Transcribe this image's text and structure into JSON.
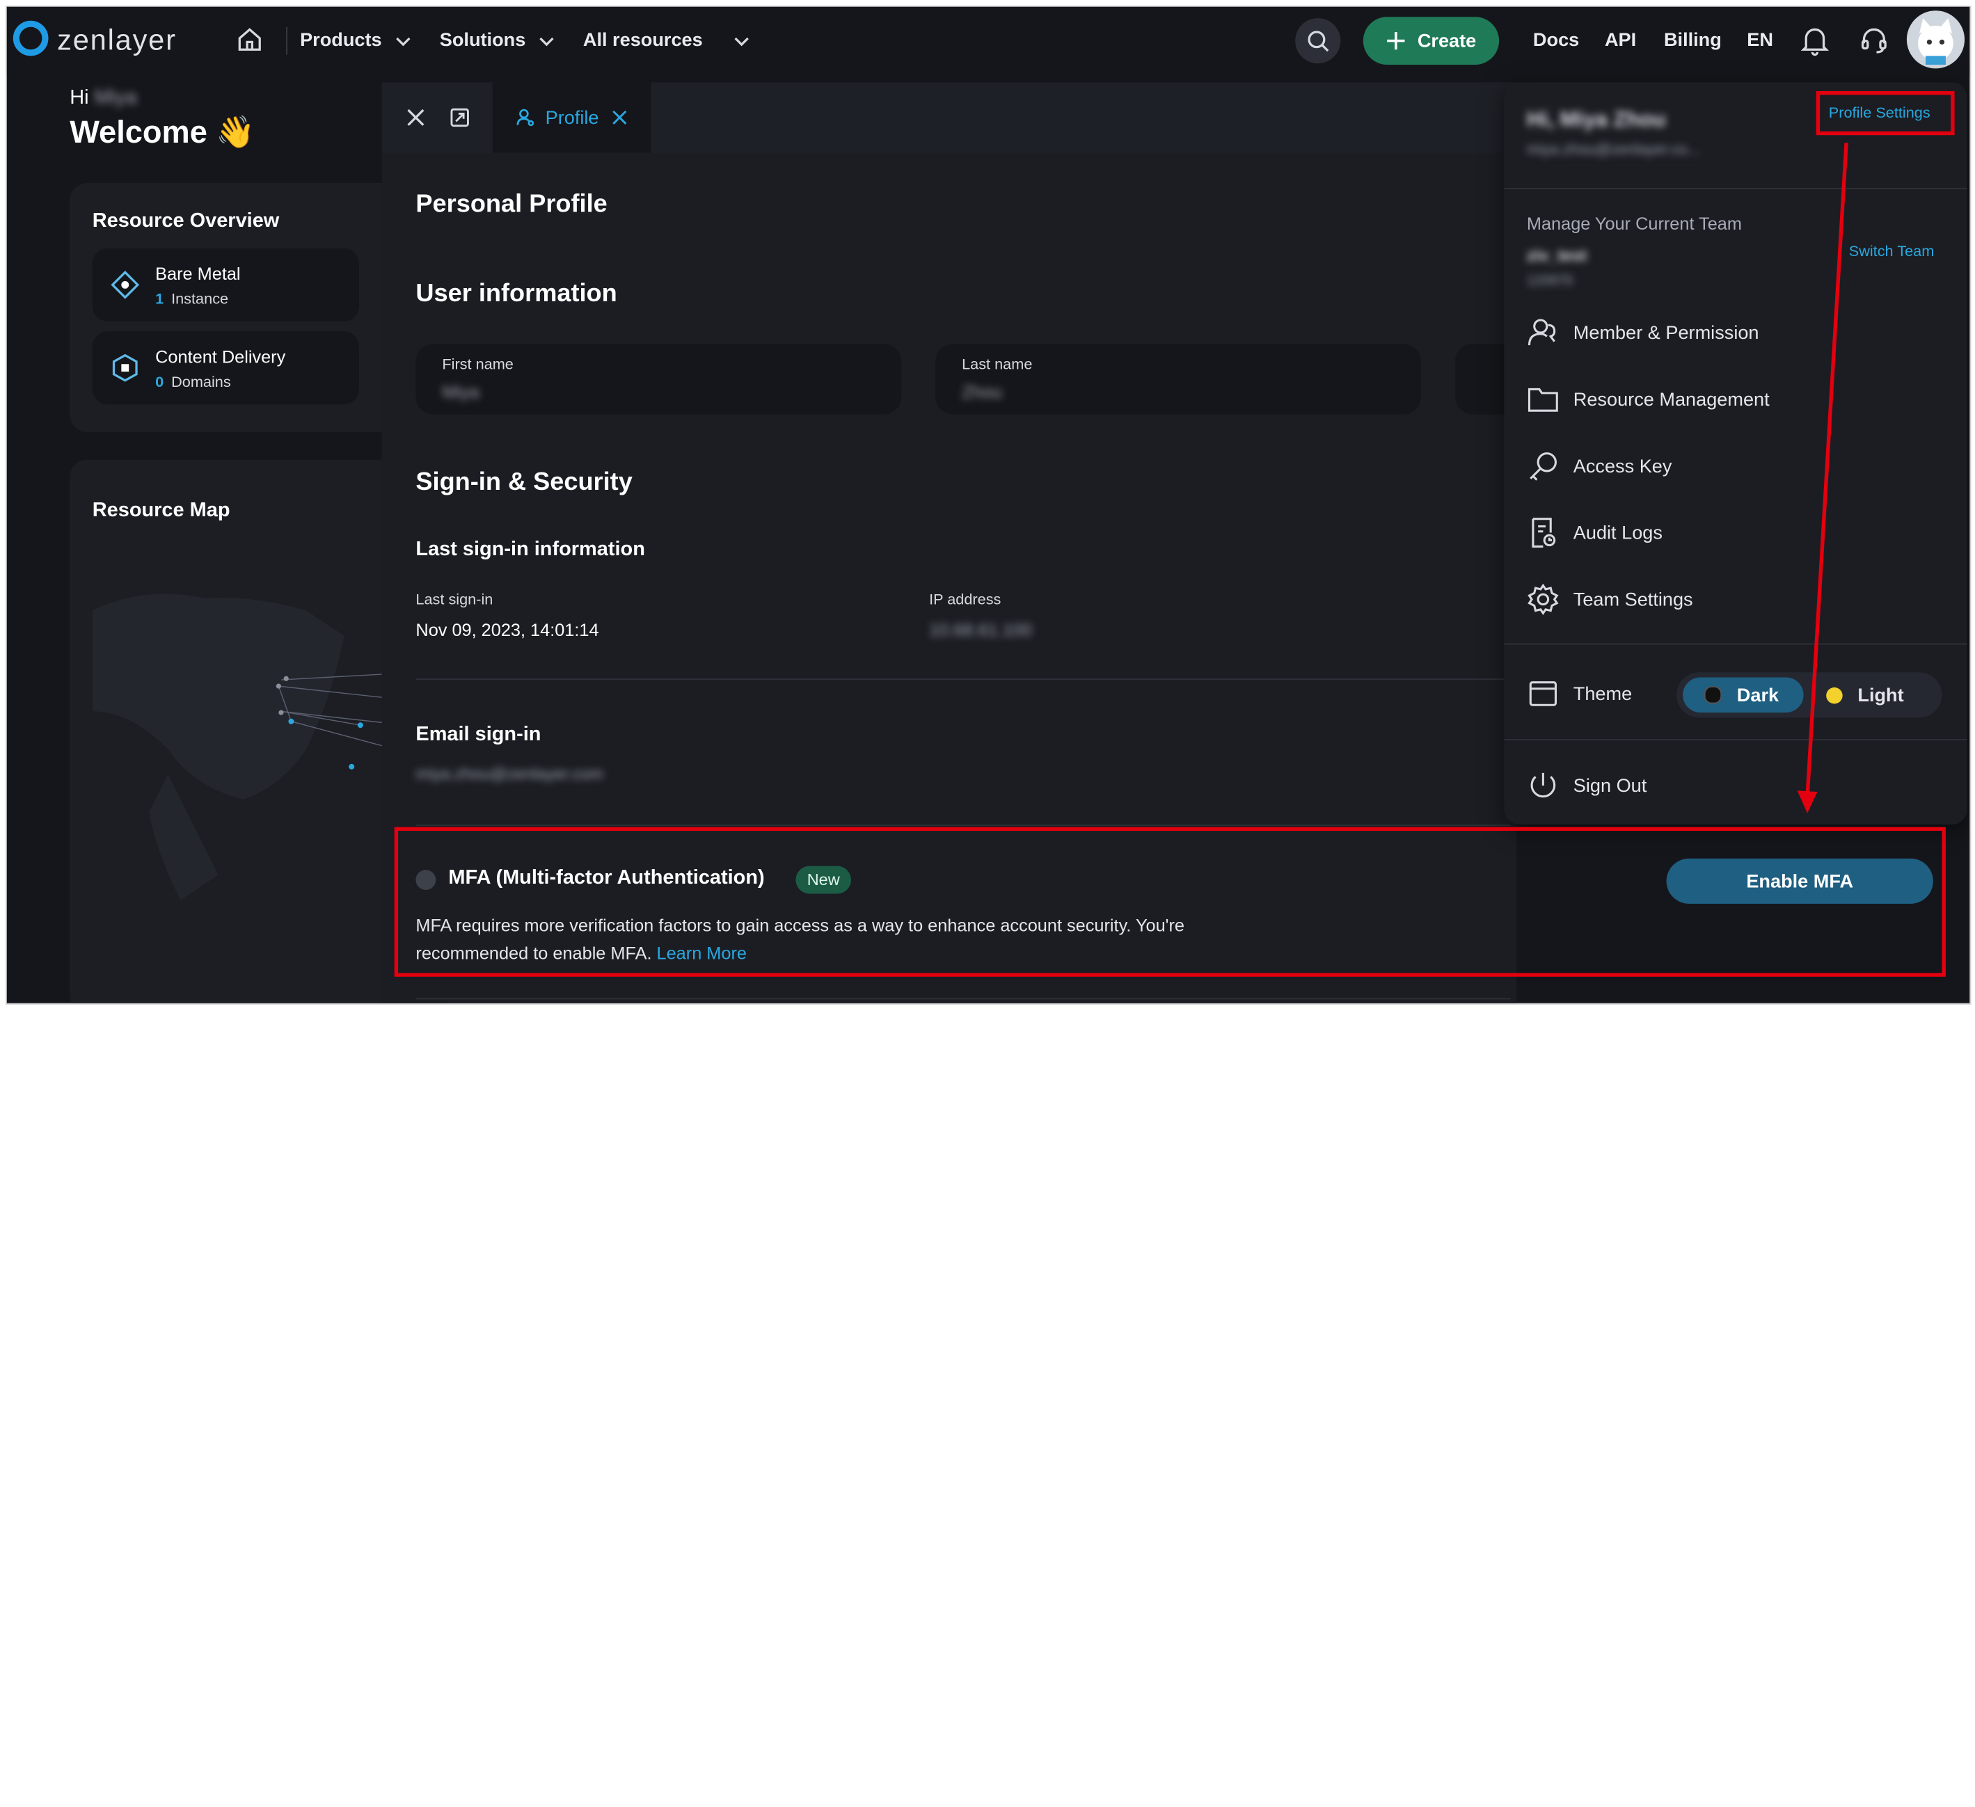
{
  "header": {
    "logo": "zenlayer",
    "nav": [
      "Products",
      "Solutions",
      "All resources"
    ],
    "create_label": "Create",
    "links": [
      "Docs",
      "API",
      "Billing",
      "EN"
    ]
  },
  "welcome": {
    "hi": "Hi",
    "name_blurred": "Miya",
    "title": "Welcome",
    "emoji": "👋"
  },
  "overview": {
    "title": "Resource Overview",
    "items": [
      {
        "label": "Bare Metal",
        "count": "1",
        "unit": "Instance"
      },
      {
        "label": "Content Delivery",
        "count": "0",
        "unit": "Domains"
      }
    ],
    "map_title": "Resource Map"
  },
  "drawer": {
    "tab_label": "Profile",
    "page_title": "Personal Profile",
    "user_info_title": "User information",
    "first_name_label": "First name",
    "first_name_value": "Miya",
    "last_name_label": "Last name",
    "last_name_value": "Zhou",
    "security_title": "Sign-in & Security",
    "last_signin_title": "Last sign-in information",
    "last_signin_label": "Last sign-in",
    "last_signin_value": "Nov 09, 2023, 14:01:14",
    "ip_label": "IP address",
    "ip_value": "10.68.61.100",
    "email_title": "Email sign-in",
    "email_value": "miya.zhou@zenlayer.com",
    "mfa_title": "MFA (Multi-factor Authentication)",
    "mfa_badge": "New",
    "mfa_desc_1": "MFA requires more verification factors to gain access as a way to enhance account security. You're",
    "mfa_desc_2": "recommended to enable MFA.",
    "mfa_learn_more": "Learn More",
    "mfa_button": "Enable MFA"
  },
  "user_menu": {
    "greeting": "Hi, Miya Zhou",
    "email": "miya.zhou@zenlayer.co...",
    "profile_settings": "Profile Settings",
    "team_header": "Manage Your Current Team",
    "team_name": "ziv_test",
    "team_id": "120970",
    "switch_team": "Switch Team",
    "items": [
      "Member & Permission",
      "Resource Management",
      "Access Key",
      "Audit Logs",
      "Team Settings"
    ],
    "theme_label": "Theme",
    "theme_dark": "Dark",
    "theme_light": "Light",
    "sign_out": "Sign Out"
  },
  "colors": {
    "background": "#15161b",
    "accent_blue": "#29a8e0",
    "create_green": "#1f7a57",
    "highlight_red": "#e3000f"
  }
}
